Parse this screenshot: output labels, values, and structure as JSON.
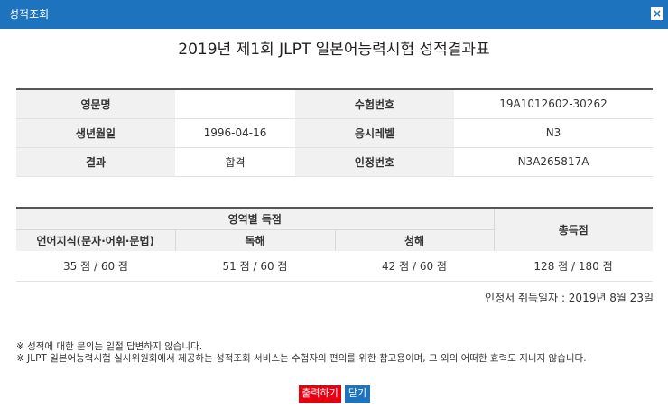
{
  "window": {
    "title": "성적조회",
    "close_glyph": "×"
  },
  "report_title": "2019년 제1회 JLPT 일본어능력시험 성적결과표",
  "info": {
    "name_label": "영문명",
    "name_value": "",
    "exam_no_label": "수험번호",
    "exam_no_value": "19A1012602-30262",
    "birth_label": "생년월일",
    "birth_value": "1996-04-16",
    "level_label": "응시레벨",
    "level_value": "N3",
    "result_label": "결과",
    "result_value": "합격",
    "cert_no_label": "인정번호",
    "cert_no_value": "N3A265817A"
  },
  "scores": {
    "section_header": "영역별 득점",
    "total_header": "총득점",
    "col_vocab": "언어지식(문자·어휘·문법)",
    "col_reading": "독해",
    "col_listening": "청해",
    "vocab_score": "35 점 / 60 점",
    "reading_score": "51 점 / 60 점",
    "listening_score": "42 점 / 60 점",
    "total_score": "128 점 / 180 점"
  },
  "issue_date": "인정서 취득일자 : 2019년 8월 23일",
  "notes": [
    "※ 성적에 대한 문의는 일절 답변하지 않습니다.",
    "※ JLPT 일본어능력시험 실시위원회에서 제공하는 성적조회 서비스는 수험자의 편의를 위한 참고용이며, 그 외의 어떠한 효력도 지니지 않습니다."
  ],
  "buttons": {
    "print": "출력하기",
    "close": "닫기"
  },
  "colors": {
    "titlebar": "#1e73be",
    "print_button": "#e60012",
    "close_button": "#1e73be"
  }
}
